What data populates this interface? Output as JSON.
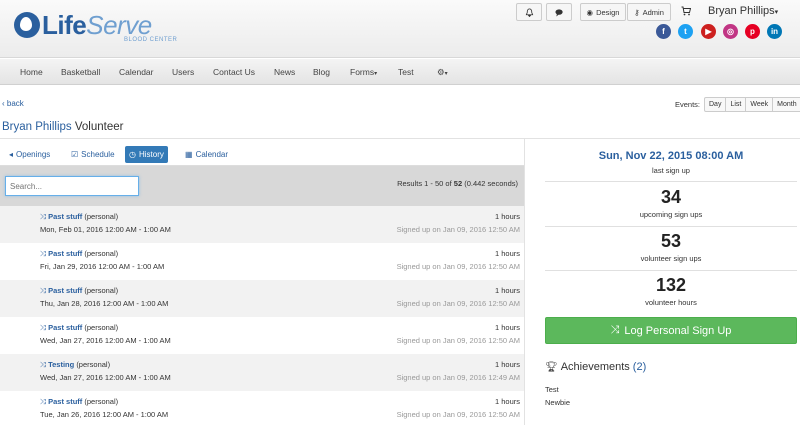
{
  "brand": {
    "name_a": "Life",
    "name_b": "Serve",
    "sub": "BLOOD CENTER"
  },
  "header": {
    "design_label": "Design",
    "admin_label": "Admin",
    "user_name": "Bryan Phillips"
  },
  "social": [
    {
      "icon": "facebook-icon",
      "glyph": "f",
      "color": "#3b5998"
    },
    {
      "icon": "twitter-icon",
      "glyph": "t",
      "color": "#1da1f2"
    },
    {
      "icon": "youtube-icon",
      "glyph": "▶",
      "color": "#cd201f"
    },
    {
      "icon": "instagram-icon",
      "glyph": "◎",
      "color": "#c13584"
    },
    {
      "icon": "pinterest-icon",
      "glyph": "p",
      "color": "#e60023"
    },
    {
      "icon": "linkedin-icon",
      "glyph": "in",
      "color": "#0077b5"
    }
  ],
  "nav": {
    "home": "Home",
    "basketball": "Basketball",
    "calendar": "Calendar",
    "users": "Users",
    "contact": "Contact Us",
    "news": "News",
    "blog": "Blog",
    "forms": "Forms",
    "test": "Test"
  },
  "back_label": "back",
  "events": {
    "label": "Events:",
    "day": "Day",
    "list": "List",
    "week": "Week",
    "month": "Month"
  },
  "page_title": {
    "name": "Bryan Phillips",
    "suffix": " Volunteer"
  },
  "tabs": {
    "openings": "Openings",
    "schedule": "Schedule",
    "history": "History",
    "calendar": "Calendar"
  },
  "search": {
    "placeholder": "Search..."
  },
  "results": {
    "prefix": "Results 1 - 50 of ",
    "total": "52",
    "suffix": " (0.442 seconds)"
  },
  "rows": [
    {
      "name": "Past stuff",
      "kind": "(personal)",
      "date": "Mon, Feb 01, 2016 12:00 AM - 1:00 AM",
      "hours": "1 hours",
      "signed": "Signed up on Jan 09, 2016 12:50 AM"
    },
    {
      "name": "Past stuff",
      "kind": "(personal)",
      "date": "Fri, Jan 29, 2016 12:00 AM - 1:00 AM",
      "hours": "1 hours",
      "signed": "Signed up on Jan 09, 2016 12:50 AM"
    },
    {
      "name": "Past stuff",
      "kind": "(personal)",
      "date": "Thu, Jan 28, 2016 12:00 AM - 1:00 AM",
      "hours": "1 hours",
      "signed": "Signed up on Jan 09, 2016 12:50 AM"
    },
    {
      "name": "Past stuff",
      "kind": "(personal)",
      "date": "Wed, Jan 27, 2016 12:00 AM - 1:00 AM",
      "hours": "1 hours",
      "signed": "Signed up on Jan 09, 2016 12:50 AM"
    },
    {
      "name": "Testing",
      "kind": "(personal)",
      "date": "Wed, Jan 27, 2016 12:00 AM - 1:00 AM",
      "hours": "1 hours",
      "signed": "Signed up on Jan 09, 2016 12:49 AM"
    },
    {
      "name": "Past stuff",
      "kind": "(personal)",
      "date": "Tue, Jan 26, 2016 12:00 AM - 1:00 AM",
      "hours": "1 hours",
      "signed": "Signed up on Jan 09, 2016 12:50 AM"
    }
  ],
  "stats": {
    "last_date": "Sun, Nov 22, 2015 08:00 AM",
    "last_label": "last sign up",
    "upcoming": "34",
    "upcoming_label": "upcoming sign ups",
    "volunteer": "53",
    "volunteer_label": "volunteer sign ups",
    "hours": "132",
    "hours_label": "volunteer hours"
  },
  "log_button": "Log Personal Sign Up",
  "achievements": {
    "title": "Achievements",
    "count": "(2)",
    "items": [
      "Test",
      "Newbie"
    ]
  },
  "colors": {
    "brand_blue": "#2a5f9e",
    "active_tab": "#337ab7",
    "success": "#5cb85c"
  }
}
